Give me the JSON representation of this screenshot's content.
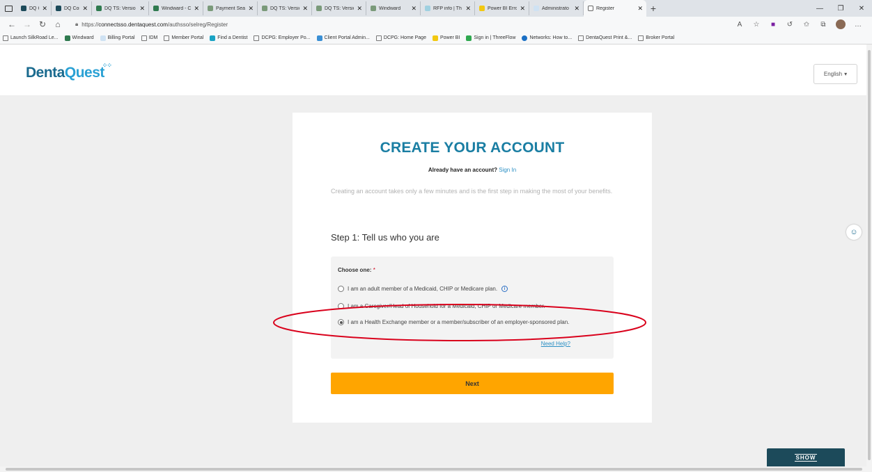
{
  "browser": {
    "tabs": [
      {
        "label": "DQ Connect",
        "color": "#1c4a5a"
      },
      {
        "label": "DQ Connect",
        "color": "#1c4a5a"
      },
      {
        "label": "DQ TS: Versio",
        "color": "#2f7a4f"
      },
      {
        "label": "Windward - C",
        "color": "#2f7a4f"
      },
      {
        "label": "Payment Sea",
        "color": "#7a9a7a"
      },
      {
        "label": "DQ TS: Versio",
        "color": "#7a9a7a"
      },
      {
        "label": "DQ TS: Versio",
        "color": "#7a9a7a"
      },
      {
        "label": "Windward",
        "color": "#7a9a7a"
      },
      {
        "label": "RFP info | Th",
        "color": "#9fd0e0"
      },
      {
        "label": "Power BI Erro",
        "color": "#f2c811"
      },
      {
        "label": "Administrato",
        "color": "#cfe2f3"
      }
    ],
    "active_tab": "Register",
    "url_prefix": "https://",
    "url_host": "connectsso.dentaquest.com",
    "url_path": "/authsso/selreg/Register",
    "bookmarks": [
      {
        "label": "Launch SilkRoad Le...",
        "color": ""
      },
      {
        "label": "Windward",
        "color": "#2f7a4f"
      },
      {
        "label": "Billing Portal",
        "color": "#cfe2f3"
      },
      {
        "label": "IDM",
        "color": ""
      },
      {
        "label": "Member Portal",
        "color": ""
      },
      {
        "label": "Find a Dentist",
        "color": "#1aa3c4"
      },
      {
        "label": "DCPG: Employer Po...",
        "color": ""
      },
      {
        "label": "Client Portal Admin...",
        "color": "#3a8fd4"
      },
      {
        "label": "DCPG: Home Page",
        "color": ""
      },
      {
        "label": "Power BI",
        "color": "#f2c811"
      },
      {
        "label": "Sign in | ThreeFlow",
        "color": "#2fa84f"
      },
      {
        "label": "Networks: How to...",
        "color": "#1a6fc4"
      },
      {
        "label": "DentaQuest Print &...",
        "color": ""
      },
      {
        "label": "Broker Portal",
        "color": ""
      }
    ]
  },
  "header": {
    "logo_part1": "Denta",
    "logo_part2": "Quest",
    "language": "English"
  },
  "form": {
    "title": "CREATE YOUR ACCOUNT",
    "already_text": "Already have an account?",
    "sign_in": "Sign In",
    "intro": "Creating an account takes only a few minutes and is the first step in making the most of your benefits.",
    "step_title": "Step 1: Tell us who you are",
    "choose_label": "Choose one:",
    "required_mark": "*",
    "options": [
      {
        "label": "I am an adult member of a Medicaid, CHIP or Medicare plan.",
        "checked": false
      },
      {
        "label": "I am a Caregiver/Head of Household for a Medicaid, CHIP or Medicare member.",
        "checked": false
      },
      {
        "label": "I am a Health Exchange member or a member/subscriber of an employer-sponsored plan.",
        "checked": true
      }
    ],
    "need_help": "Need Help?",
    "next_label": "Next"
  },
  "widgets": {
    "show_label": "SHOW"
  },
  "colors": {
    "title": "#1a7ea3",
    "next_button": "#ffa500",
    "highlight": "#d9001b"
  }
}
